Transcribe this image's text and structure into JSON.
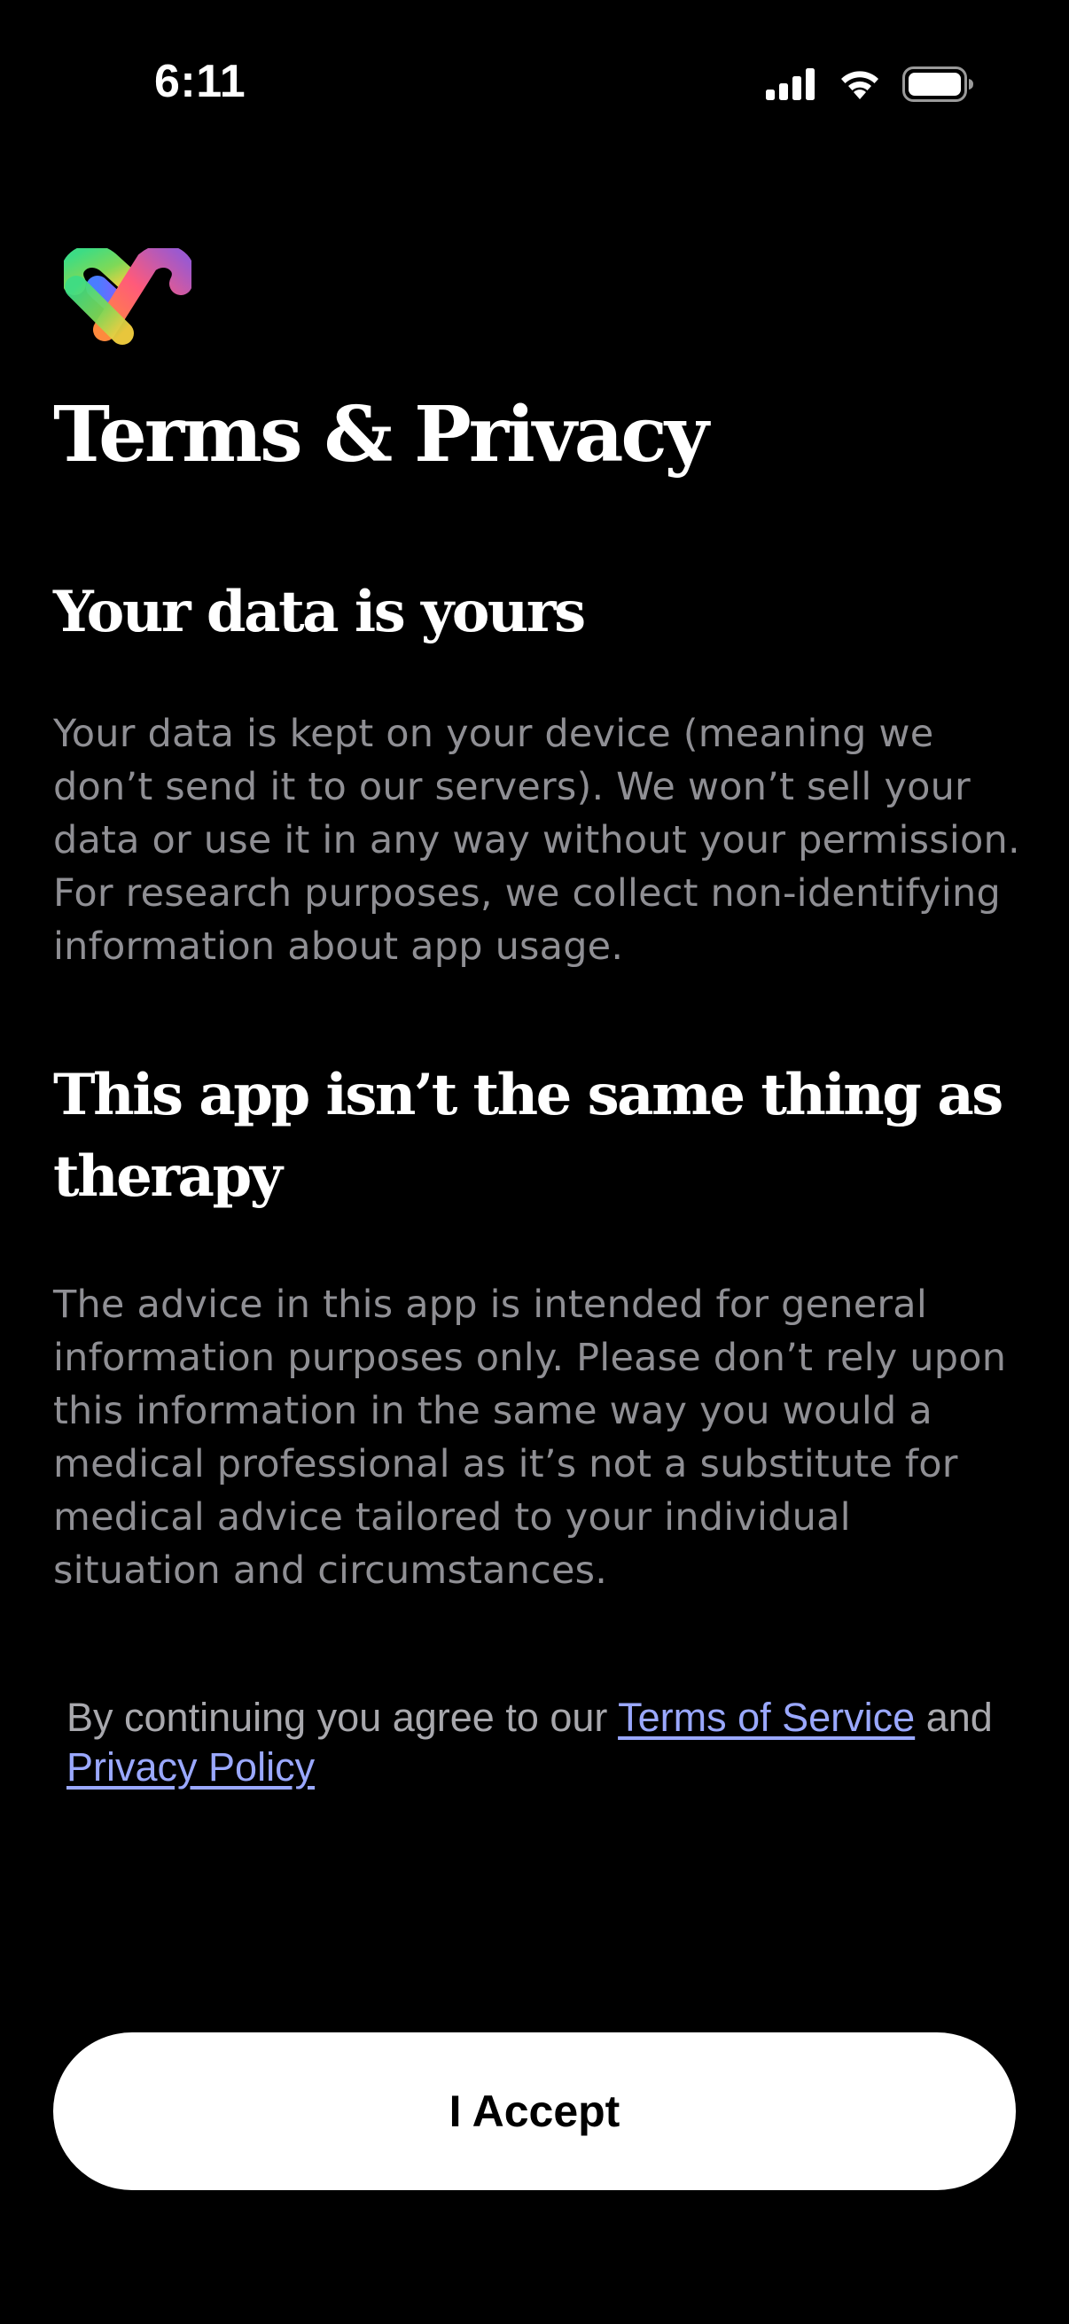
{
  "status_bar": {
    "time": "6:11",
    "icons": [
      "cellular-signal-icon",
      "wifi-icon",
      "battery-icon"
    ]
  },
  "app": {
    "logo": "heart-logo-icon"
  },
  "page": {
    "title": "Terms & Privacy"
  },
  "sections": [
    {
      "heading": "Your data is yours",
      "body": "Your data is kept on your device (meaning we don’t send it to our servers). We won’t sell your data or use it in any way without your permission. For research purposes, we collect non-identifying information about app usage."
    },
    {
      "heading": "This app isn’t the same thing as therapy",
      "body": "The advice in this app is intended for general information purposes only. Please don’t rely upon this information in the same way you would a medical professional as it’s not a substitute for medical advice tailored to your individual situation and circumstances."
    }
  ],
  "agreement": {
    "prefix": "By continuing you agree to our ",
    "terms_link": "Terms of Service",
    "conjunction": " and ",
    "privacy_link": "Privacy Policy"
  },
  "actions": {
    "accept_label": "I Accept"
  },
  "colors": {
    "background": "#000000",
    "body_text": "#8f8f94",
    "link": "#9aa8ff",
    "button_bg": "#ffffff"
  }
}
